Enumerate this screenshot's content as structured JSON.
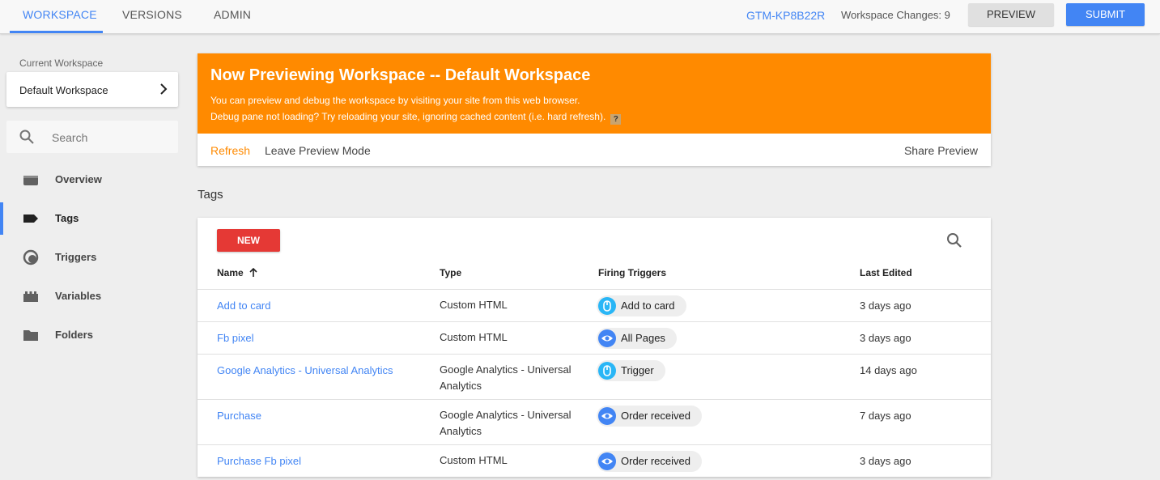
{
  "topbar": {
    "tabs": [
      {
        "label": "WORKSPACE",
        "active": true
      },
      {
        "label": "VERSIONS",
        "active": false
      },
      {
        "label": "ADMIN",
        "active": false
      }
    ],
    "container_id": "GTM-KP8B22R",
    "workspace_changes": "Workspace Changes: 9",
    "preview_label": "PREVIEW",
    "submit_label": "SUBMIT"
  },
  "sidebar": {
    "current_workspace_label": "Current Workspace",
    "workspace_name": "Default Workspace",
    "search_placeholder": "Search",
    "items": [
      {
        "label": "Overview",
        "icon": "briefcase-icon",
        "active": false
      },
      {
        "label": "Tags",
        "icon": "tag-icon",
        "active": true
      },
      {
        "label": "Triggers",
        "icon": "trigger-icon",
        "active": false
      },
      {
        "label": "Variables",
        "icon": "variables-icon",
        "active": false
      },
      {
        "label": "Folders",
        "icon": "folder-icon",
        "active": false
      }
    ]
  },
  "preview_banner": {
    "title": "Now Previewing Workspace -- Default Workspace",
    "line1": "You can preview and debug the workspace by visiting your site from this web browser.",
    "line2": "Debug pane not loading? Try reloading your site, ignoring cached content (i.e. hard refresh).",
    "help": "?",
    "refresh_label": "Refresh",
    "leave_label": "Leave Preview Mode",
    "share_label": "Share Preview"
  },
  "tags": {
    "section_title": "Tags",
    "new_label": "NEW",
    "columns": {
      "name": "Name",
      "type": "Type",
      "triggers": "Firing Triggers",
      "edited": "Last Edited"
    },
    "rows": [
      {
        "name": "Add to card",
        "type": "Custom HTML",
        "trigger": "Add to card",
        "trigger_icon": "click",
        "edited": "3 days ago"
      },
      {
        "name": "Fb pixel",
        "type": "Custom HTML",
        "trigger": "All Pages",
        "trigger_icon": "view",
        "edited": "3 days ago"
      },
      {
        "name": "Google Analytics - Universal Analytics",
        "type": "Google Analytics - Universal Analytics",
        "trigger": "Trigger",
        "trigger_icon": "click",
        "edited": "14 days ago"
      },
      {
        "name": "Purchase",
        "type": "Google Analytics - Universal Analytics",
        "trigger": "Order received",
        "trigger_icon": "view",
        "edited": "7 days ago"
      },
      {
        "name": "Purchase Fb pixel",
        "type": "Custom HTML",
        "trigger": "Order received",
        "trigger_icon": "view",
        "edited": "3 days ago"
      }
    ]
  },
  "colors": {
    "accent": "#4285f4",
    "banner": "#ff8a00",
    "new_button": "#e53935",
    "click_trigger": "#29b6f6"
  }
}
